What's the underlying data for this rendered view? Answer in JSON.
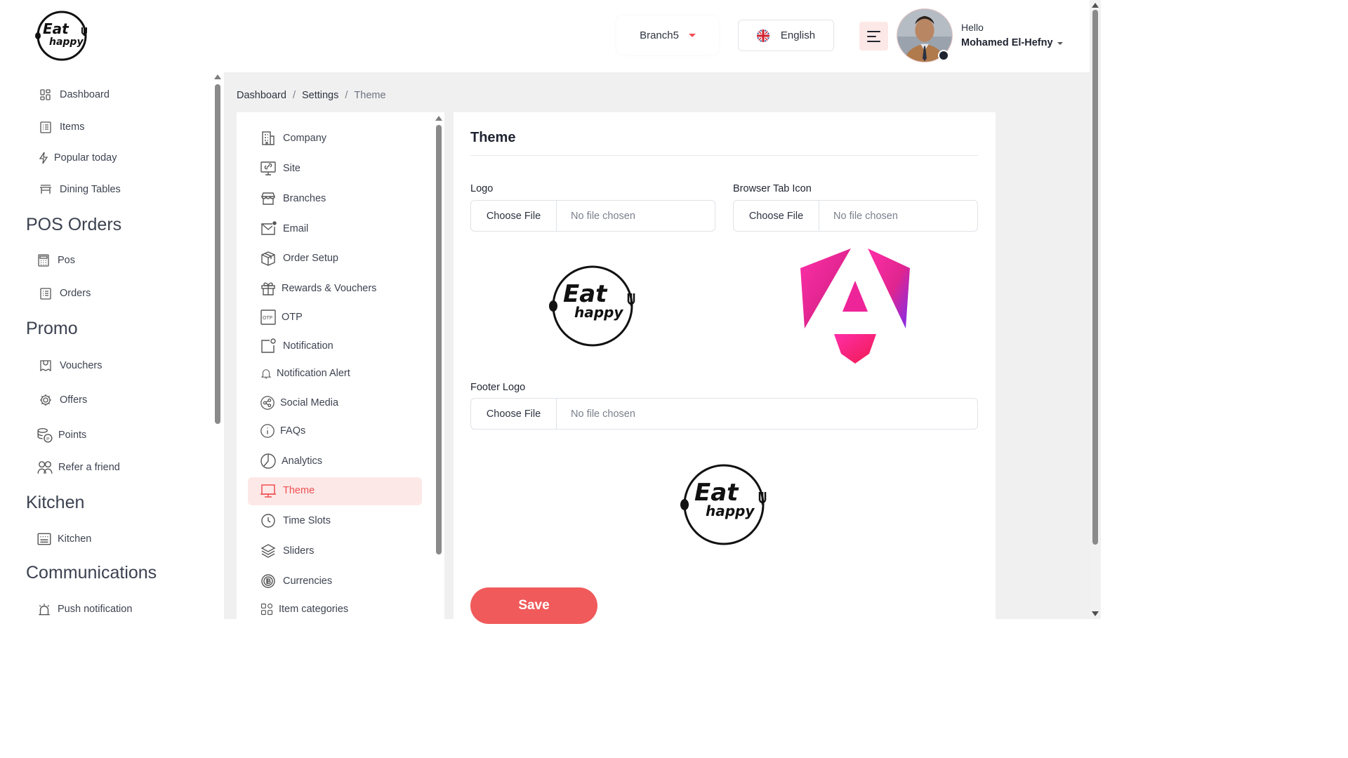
{
  "brand": {
    "logo_text_top": "Eat",
    "logo_text_bottom": "happy",
    "accent": "#f05a5b"
  },
  "header": {
    "branch": "Branch5",
    "language": "English",
    "greeting": "Hello",
    "user_name": "Mohamed El-Hefny"
  },
  "sidebar": {
    "items_top": [
      "Dashboard",
      "Items",
      "Popular today",
      "Dining Tables"
    ],
    "section_pos": "POS Orders",
    "items_pos": [
      "Pos",
      "Orders"
    ],
    "section_promo": "Promo",
    "items_promo": [
      "Vouchers",
      "Offers",
      "Points",
      "Refer a friend"
    ],
    "section_kitchen": "Kitchen",
    "items_kitchen": [
      "Kitchen"
    ],
    "section_comm": "Communications",
    "items_comm": [
      "Push notification"
    ]
  },
  "breadcrumb": [
    "Dashboard",
    "Settings",
    "Theme"
  ],
  "settings_menu": [
    "Company",
    "Site",
    "Branches",
    "Email",
    "Order Setup",
    "Rewards & Vouchers",
    "OTP",
    "Notification",
    "Notification Alert",
    "Social Media",
    "FAQs",
    "Analytics",
    "Theme",
    "Time Slots",
    "Sliders",
    "Currencies",
    "Item categories"
  ],
  "settings_active": "Theme",
  "theme": {
    "title": "Theme",
    "logo_label": "Logo",
    "browser_tab_icon_label": "Browser Tab Icon",
    "footer_logo_label": "Footer Logo",
    "choose_file": "Choose File",
    "no_file": "No file chosen",
    "save_label": "Save"
  }
}
